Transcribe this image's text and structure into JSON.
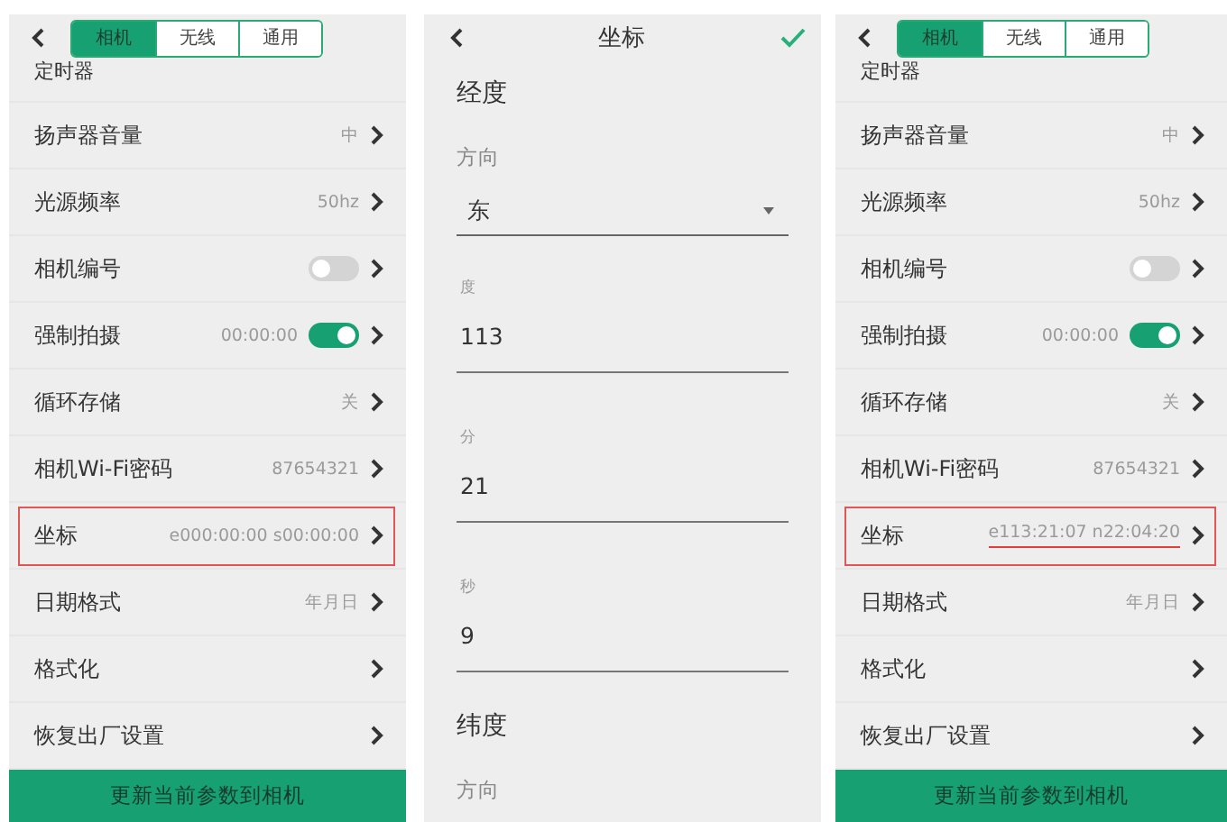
{
  "screens": [
    {
      "kind": "settings",
      "tabs": [
        {
          "label": "相机",
          "selected": true
        },
        {
          "label": "无线",
          "selected": false
        },
        {
          "label": "通用",
          "selected": false
        }
      ],
      "rows": [
        {
          "label": "定时器",
          "kind": "partial"
        },
        {
          "label": "扬声器音量",
          "value": "中",
          "kind": "chevron"
        },
        {
          "label": "光源频率",
          "value": "50hz",
          "kind": "chevron"
        },
        {
          "label": "相机编号",
          "kind": "toggle",
          "on": false
        },
        {
          "label": "强制拍摄",
          "value": "00:00:00",
          "kind": "toggle",
          "on": true
        },
        {
          "label": "循环存储",
          "value": "关",
          "kind": "chevron"
        },
        {
          "label": "相机Wi-Fi密码",
          "value": "87654321",
          "kind": "chevron"
        },
        {
          "label": "坐标",
          "value": "e000:00:00 s00:00:00",
          "kind": "chevron",
          "highlighted": true,
          "underlined": false
        },
        {
          "label": "日期格式",
          "value": "年月日",
          "kind": "chevron"
        },
        {
          "label": "格式化",
          "kind": "chevron"
        },
        {
          "label": "恢复出厂设置",
          "kind": "chevron"
        }
      ],
      "button": "更新当前参数到相机"
    },
    {
      "kind": "form",
      "title": "坐标",
      "sections": [
        {
          "heading": "经度",
          "fields": [
            {
              "kind": "select",
              "label": "方向",
              "value": "东"
            },
            {
              "kind": "text",
              "label": "度",
              "value": "113"
            },
            {
              "kind": "text",
              "label": "分",
              "value": "21"
            },
            {
              "kind": "text",
              "label": "秒",
              "value": "9"
            }
          ]
        },
        {
          "heading": "纬度",
          "fields": [
            {
              "kind": "select",
              "label": "方向"
            }
          ]
        }
      ]
    },
    {
      "kind": "settings",
      "tabs": [
        {
          "label": "相机",
          "selected": true
        },
        {
          "label": "无线",
          "selected": false
        },
        {
          "label": "通用",
          "selected": false
        }
      ],
      "rows": [
        {
          "label": "定时器",
          "kind": "partial"
        },
        {
          "label": "扬声器音量",
          "value": "中",
          "kind": "chevron"
        },
        {
          "label": "光源频率",
          "value": "50hz",
          "kind": "chevron"
        },
        {
          "label": "相机编号",
          "kind": "toggle",
          "on": false
        },
        {
          "label": "强制拍摄",
          "value": "00:00:00",
          "kind": "toggle",
          "on": true
        },
        {
          "label": "循环存储",
          "value": "关",
          "kind": "chevron"
        },
        {
          "label": "相机Wi-Fi密码",
          "value": "87654321",
          "kind": "chevron"
        },
        {
          "label": "坐标",
          "value": "e113:21:07 n22:04:20",
          "kind": "chevron",
          "highlighted": true,
          "underlined": true
        },
        {
          "label": "日期格式",
          "value": "年月日",
          "kind": "chevron"
        },
        {
          "label": "格式化",
          "kind": "chevron"
        },
        {
          "label": "恢复出厂设置",
          "kind": "chevron"
        }
      ],
      "button": "更新当前参数到相机"
    }
  ]
}
